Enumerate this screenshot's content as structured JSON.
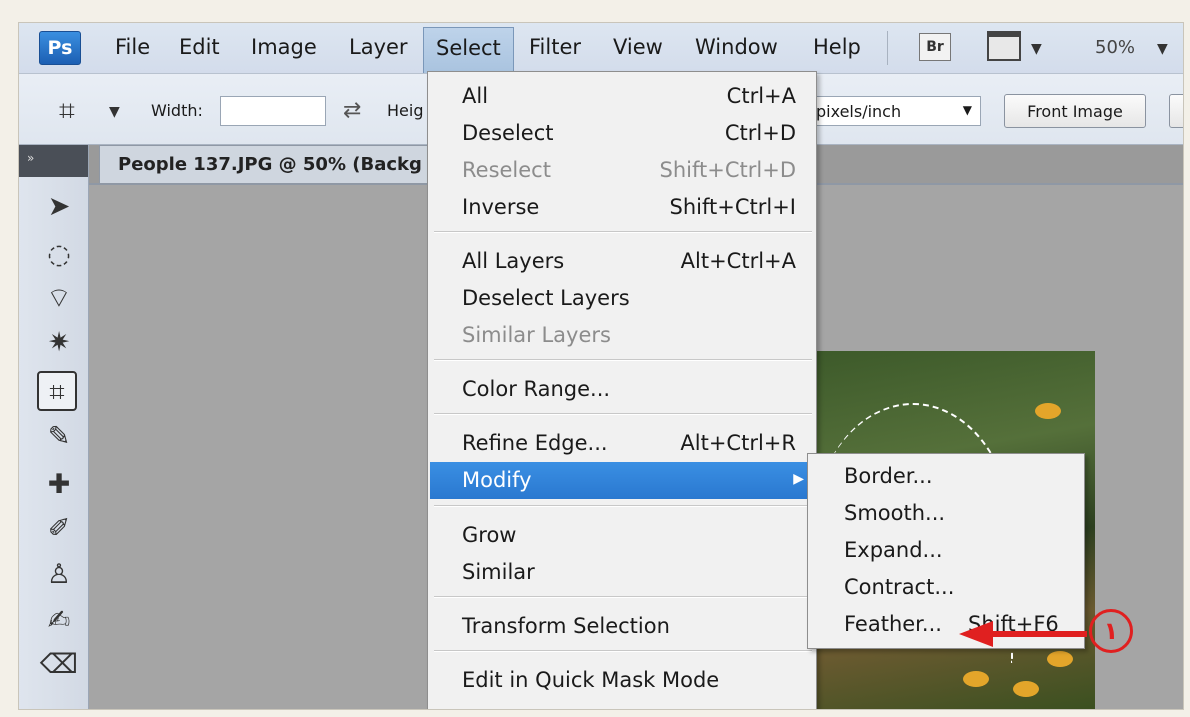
{
  "menubar": {
    "logo": "Ps",
    "items": [
      "File",
      "Edit",
      "Image",
      "Layer",
      "Select",
      "Filter",
      "View",
      "Window",
      "Help"
    ],
    "bridge": "Br",
    "zoom": "50%"
  },
  "options": {
    "width_label": "Width:",
    "height_label": "Heig",
    "resolution_unit": "pixels/inch",
    "front_image": "Front Image"
  },
  "document": {
    "tab_title": "People 137.JPG @ 50% (Backg"
  },
  "select_menu": {
    "items": [
      {
        "label": "All",
        "shortcut": "Ctrl+A"
      },
      {
        "label": "Deselect",
        "shortcut": "Ctrl+D"
      },
      {
        "label": "Reselect",
        "shortcut": "Shift+Ctrl+D"
      },
      {
        "label": "Inverse",
        "shortcut": "Shift+Ctrl+I"
      },
      {
        "label": "All Layers",
        "shortcut": "Alt+Ctrl+A"
      },
      {
        "label": "Deselect Layers",
        "shortcut": ""
      },
      {
        "label": "Similar Layers",
        "shortcut": ""
      },
      {
        "label": "Color Range...",
        "shortcut": ""
      },
      {
        "label": "Refine Edge...",
        "shortcut": "Alt+Ctrl+R"
      },
      {
        "label": "Modify",
        "shortcut": ""
      },
      {
        "label": "Grow",
        "shortcut": ""
      },
      {
        "label": "Similar",
        "shortcut": ""
      },
      {
        "label": "Transform Selection",
        "shortcut": ""
      },
      {
        "label": "Edit in Quick Mask Mode",
        "shortcut": ""
      }
    ]
  },
  "modify_submenu": {
    "items": [
      {
        "label": "Border..."
      },
      {
        "label": "Smooth..."
      },
      {
        "label": "Expand..."
      },
      {
        "label": "Contract..."
      },
      {
        "label": "Feather...",
        "shortcut": "Shift+F6"
      }
    ]
  },
  "annotation": {
    "marker": "١",
    "color": "#e02020"
  },
  "colors": {
    "highlight": "#2a78d0",
    "menubar": "#d3dceb"
  }
}
